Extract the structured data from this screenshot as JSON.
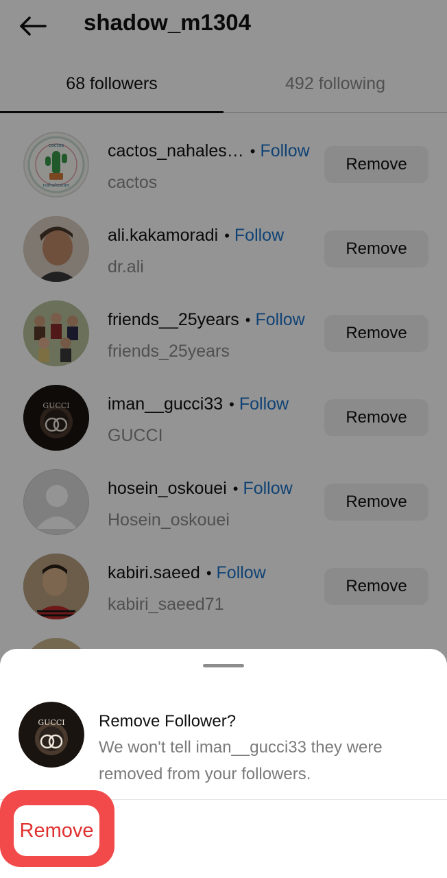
{
  "header": {
    "title": "shadow_m1304",
    "back_icon": "arrow-left-icon"
  },
  "tabs": [
    {
      "label": "68 followers",
      "active": true
    },
    {
      "label": "492 following",
      "active": false
    }
  ],
  "followers": [
    {
      "username": "cactos_nahales…",
      "name": "cactos",
      "follow_label": "Follow",
      "remove_label": "Remove",
      "avatar": "cactus-logo"
    },
    {
      "username": "ali.kakamoradi",
      "name": "dr.ali",
      "follow_label": "Follow",
      "remove_label": "Remove",
      "avatar": "photo"
    },
    {
      "username": "friends__25years",
      "name": "friends_25years",
      "follow_label": "Follow",
      "remove_label": "Remove",
      "avatar": "group-photo"
    },
    {
      "username": "iman__gucci33",
      "name": "GUCCI",
      "follow_label": "Follow",
      "remove_label": "Remove",
      "avatar": "gucci-logo"
    },
    {
      "username": "hosein_oskouei",
      "name": "Hosein_oskouei",
      "follow_label": "Follow",
      "remove_label": "Remove",
      "avatar": "default-avatar"
    },
    {
      "username": "kabiri.saeed",
      "name": "kabiri_saeed71",
      "follow_label": "Follow",
      "remove_label": "Remove",
      "avatar": "photo"
    }
  ],
  "separator": "•",
  "sheet": {
    "title": "Remove Follower?",
    "message": "We won't tell iman__gucci33 they were removed from your followers.",
    "remove_label": "Remove",
    "avatar": "gucci-logo"
  },
  "colors": {
    "follow": "#1a73c9",
    "remove_destructive": "#e03030",
    "highlight_ring": "#f24a4a"
  }
}
